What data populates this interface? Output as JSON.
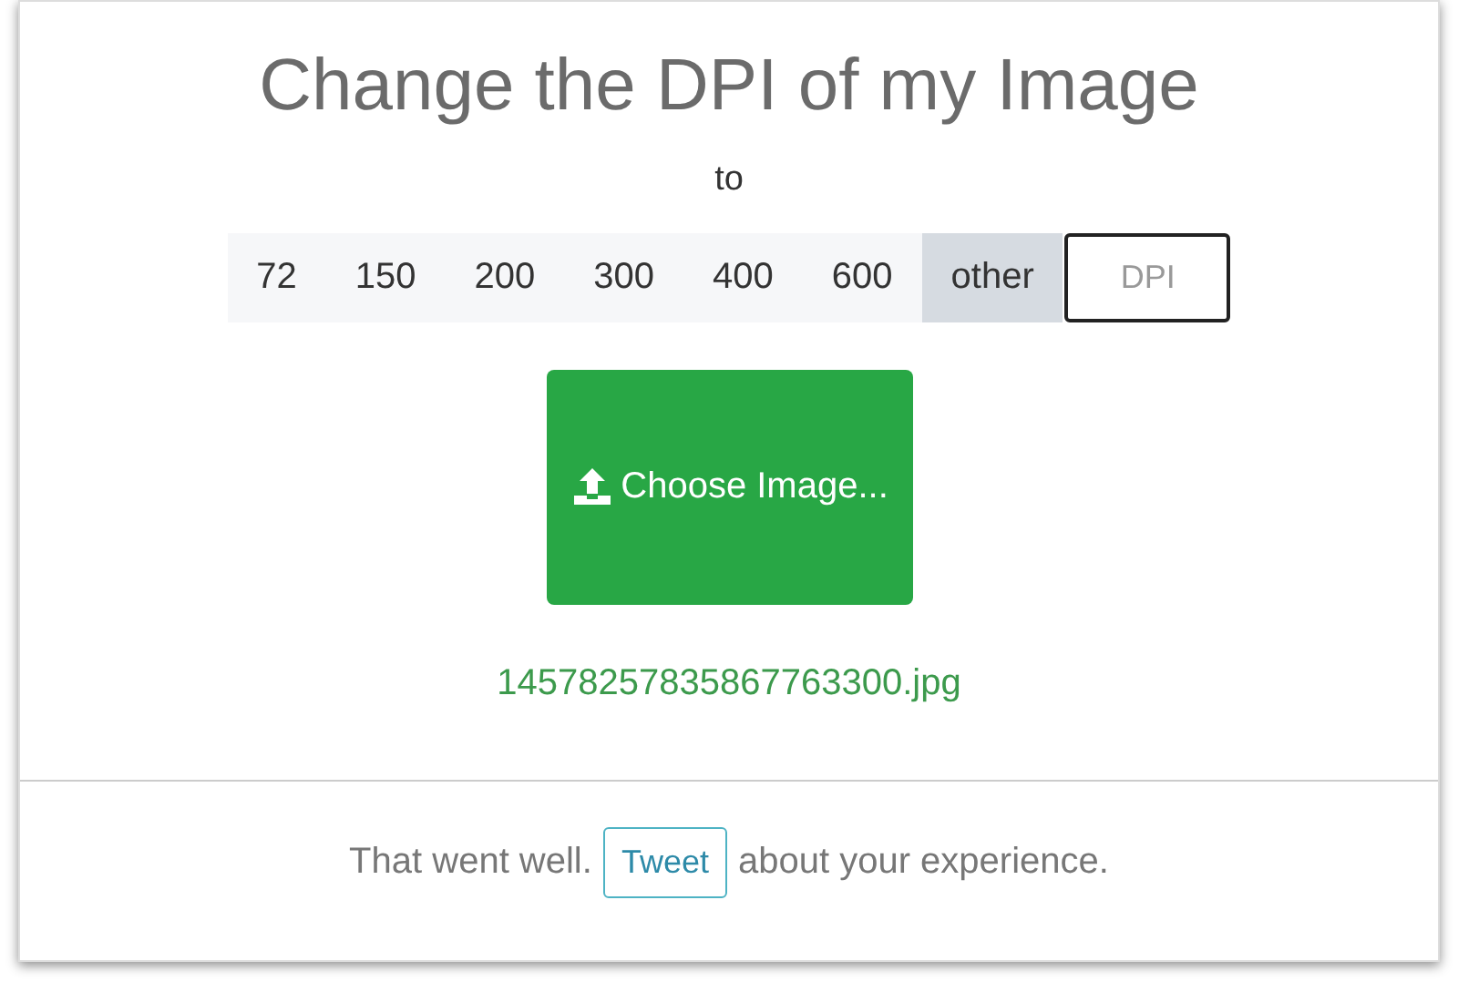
{
  "title": "Change the DPI of my Image",
  "subtitle": "to",
  "dpi_options": [
    {
      "label": "72",
      "selected": false
    },
    {
      "label": "150",
      "selected": false
    },
    {
      "label": "200",
      "selected": false
    },
    {
      "label": "300",
      "selected": false
    },
    {
      "label": "400",
      "selected": false
    },
    {
      "label": "600",
      "selected": false
    },
    {
      "label": "other",
      "selected": true
    }
  ],
  "dpi_field": {
    "placeholder": "DPI"
  },
  "upload_button": "Choose Image...",
  "file_name": "14578257835867763300.jpg",
  "footer": {
    "before": "That went well.",
    "button": "Tweet",
    "after": "about your experience."
  }
}
